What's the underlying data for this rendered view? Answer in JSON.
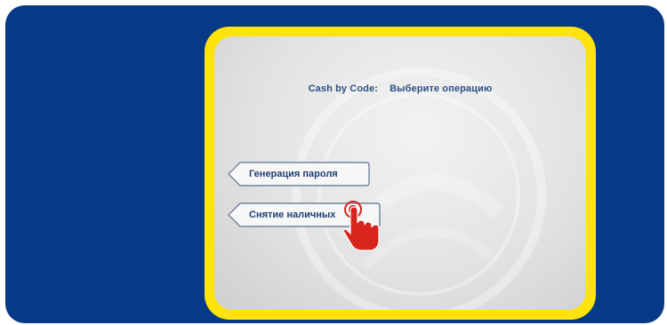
{
  "screen": {
    "title_prefix": "Cash by Code:",
    "title_prompt": "Выберите операцию"
  },
  "menu": {
    "items": [
      {
        "label": "Генерация пароля"
      },
      {
        "label": "Снятие наличных"
      }
    ]
  },
  "colors": {
    "frame": "#063a86",
    "screen_border": "#ffe30a",
    "text": "#1f3f74",
    "cursor": "#d8241c"
  },
  "icons": {
    "cursor": "hand-pointer-icon",
    "watermark": "bank-seal-watermark"
  }
}
